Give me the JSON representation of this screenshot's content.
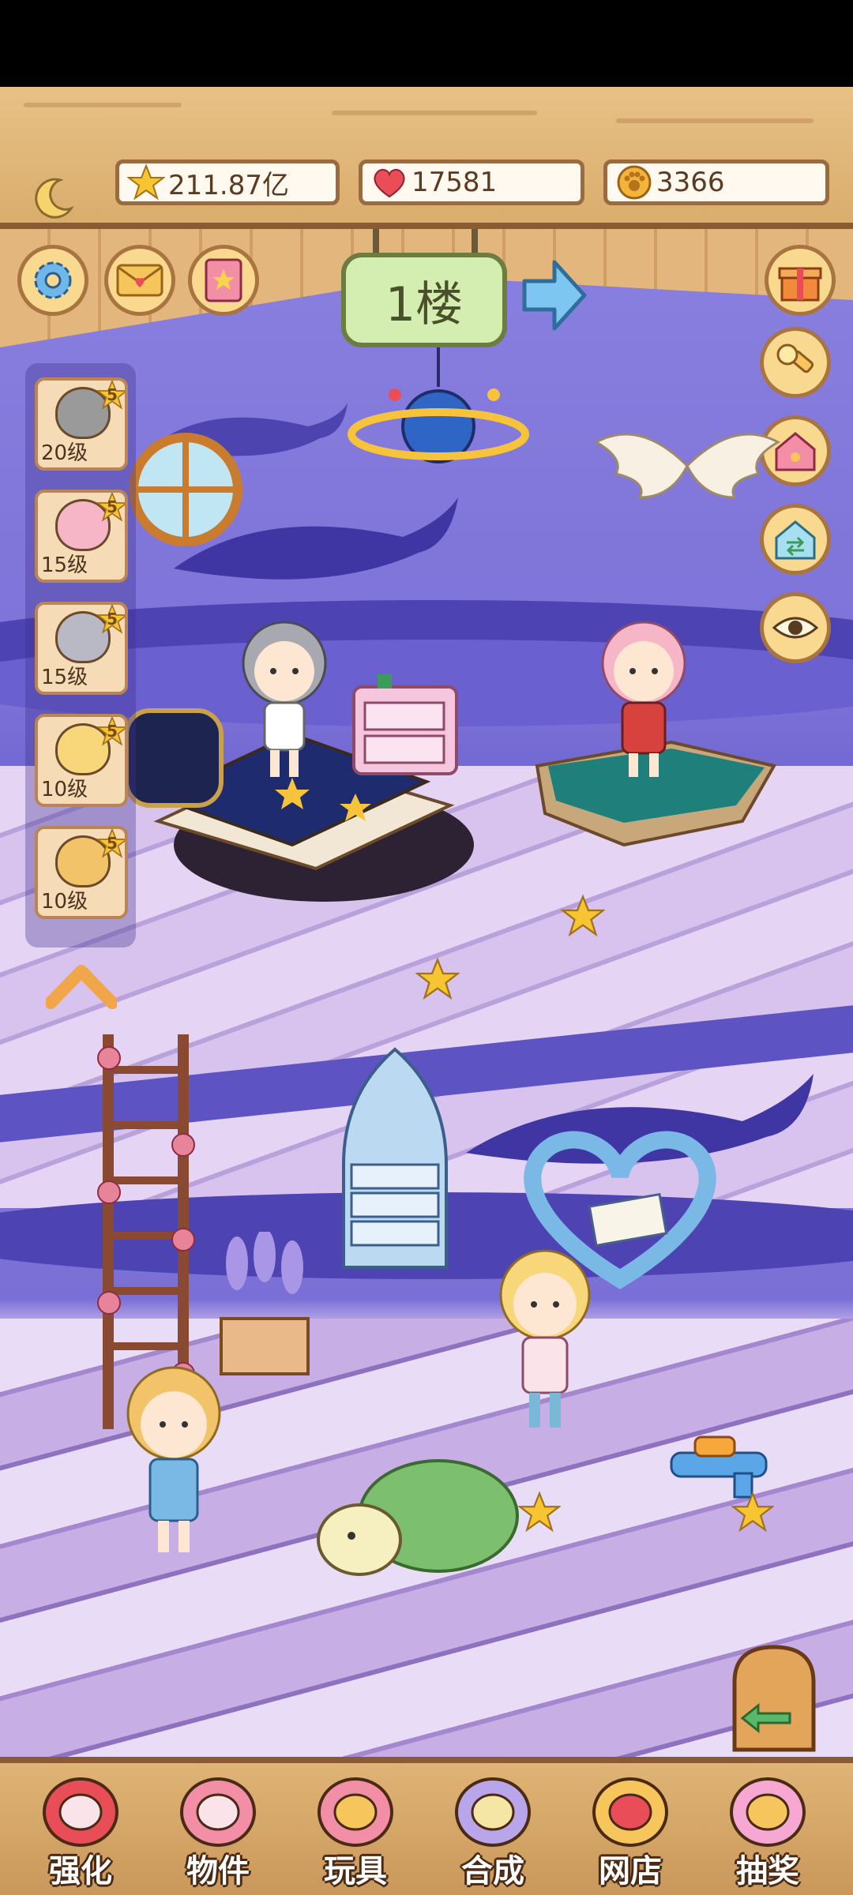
{
  "resources": {
    "stars": "211.87亿",
    "hearts": "17581",
    "coins": "3366"
  },
  "floor": {
    "label": "1楼"
  },
  "characters": [
    {
      "level": "20级",
      "stars": "5",
      "hair": "#9a9a9a"
    },
    {
      "level": "15级",
      "stars": "5",
      "hair": "#f6b6c8"
    },
    {
      "level": "15级",
      "stars": "5",
      "hair": "#b9b9c6"
    },
    {
      "level": "10级",
      "stars": "5",
      "hair": "#f7d77a"
    },
    {
      "level": "10级",
      "stars": "5",
      "hair": "#f3c36a"
    }
  ],
  "nav": [
    {
      "label": "强化",
      "icon": "lollipop-icon"
    },
    {
      "label": "物件",
      "icon": "piano-icon"
    },
    {
      "label": "玩具",
      "icon": "toy-house-icon"
    },
    {
      "label": "合成",
      "icon": "synthesis-cards-icon"
    },
    {
      "label": "网店",
      "icon": "shop-cart-icon"
    },
    {
      "label": "抽奖",
      "icon": "lottery-wheel-icon"
    }
  ],
  "colors": {
    "wood": "#d9ad6c",
    "wall": "#7c72d8",
    "floor": "#e2d5f6",
    "accent": "#f2c23a"
  }
}
